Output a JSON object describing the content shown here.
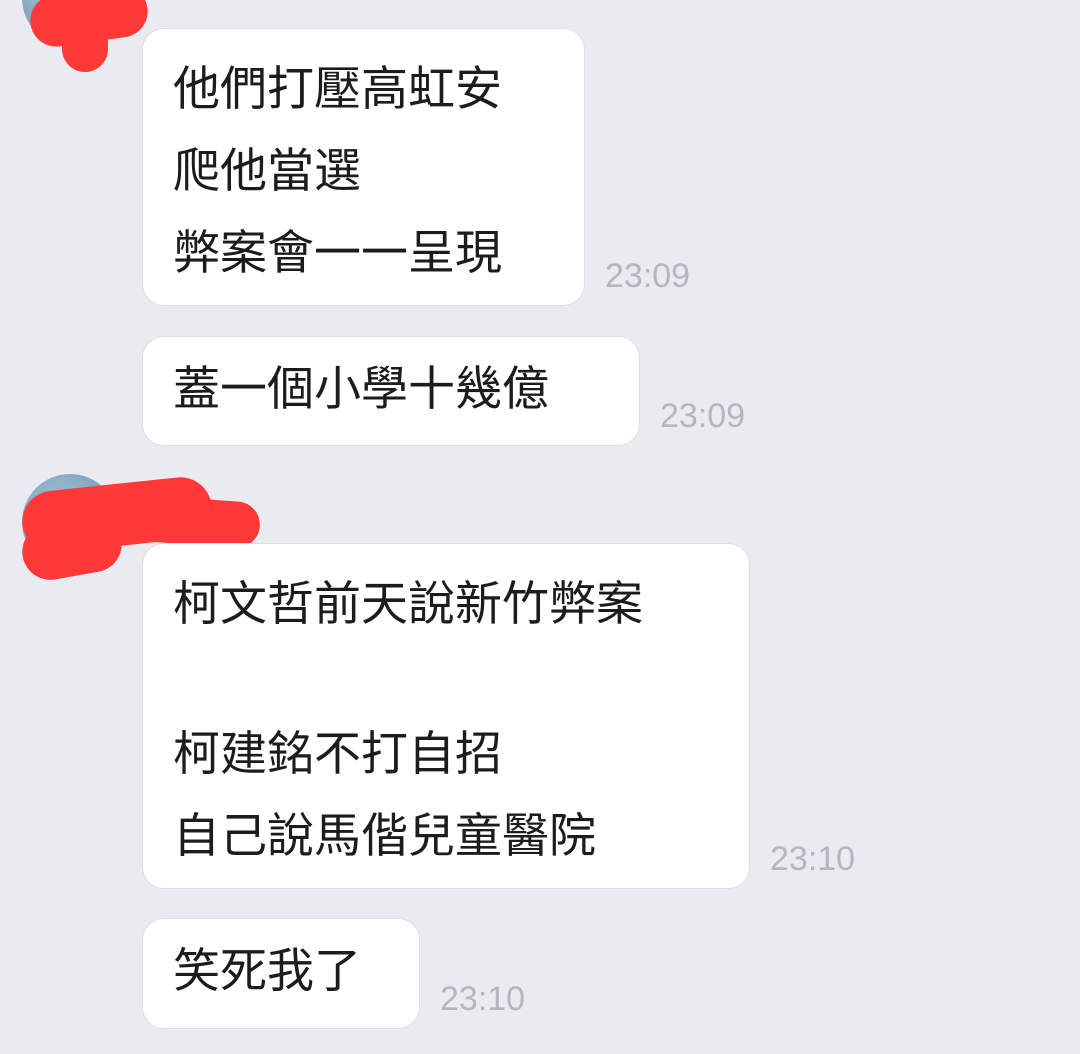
{
  "chat": {
    "messages": [
      {
        "lines": [
          "他們打壓高虹安",
          "爬他當選",
          "弊案會一一呈現"
        ],
        "time": "23:09"
      },
      {
        "lines": [
          "蓋一個小學十幾億"
        ],
        "time": "23:09"
      },
      {
        "lines": [
          "柯文哲前天說新竹弊案",
          "",
          "柯建銘不打自招",
          "自己說馬偕兒童醫院"
        ],
        "time": "23:10"
      },
      {
        "lines": [
          "笑死我了"
        ],
        "time": "23:10"
      }
    ]
  },
  "colors": {
    "background": "#e9ebf0",
    "bubble": "#ffffff",
    "timestamp": "#b3b7bf",
    "redaction": "#ff3838"
  }
}
